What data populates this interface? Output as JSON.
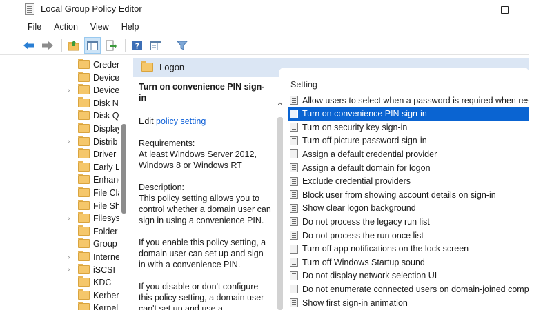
{
  "window": {
    "title": "Local Group Policy Editor"
  },
  "menu": [
    "File",
    "Action",
    "View",
    "Help"
  ],
  "toolbar": {
    "icons": [
      "back-arrow-icon",
      "forward-arrow-icon",
      "up-folder-icon",
      "show-hide-tree-icon",
      "export-list-icon",
      "help-icon",
      "extended-view-icon",
      "filter-icon"
    ]
  },
  "tree": {
    "items": [
      {
        "label": "Creden",
        "expandable": false
      },
      {
        "label": "Device",
        "expandable": false
      },
      {
        "label": "Device",
        "expandable": true
      },
      {
        "label": "Disk N",
        "expandable": false
      },
      {
        "label": "Disk Q",
        "expandable": false
      },
      {
        "label": "Display",
        "expandable": false
      },
      {
        "label": "Distrib",
        "expandable": true
      },
      {
        "label": "Driver",
        "expandable": false
      },
      {
        "label": "Early La",
        "expandable": false
      },
      {
        "label": "Enhanc",
        "expandable": false
      },
      {
        "label": "File Cla",
        "expandable": false
      },
      {
        "label": "File Sh",
        "expandable": false
      },
      {
        "label": "Filesys",
        "expandable": true
      },
      {
        "label": "Folder",
        "expandable": false
      },
      {
        "label": "Group",
        "expandable": false
      },
      {
        "label": "Interne",
        "expandable": true
      },
      {
        "label": "iSCSI",
        "expandable": true
      },
      {
        "label": "KDC",
        "expandable": false
      },
      {
        "label": "Kerbero",
        "expandable": false
      },
      {
        "label": "Kernel",
        "expandable": false
      }
    ]
  },
  "panel": {
    "folder_title": "Logon"
  },
  "description": {
    "title": "Turn on convenience PIN sign-in",
    "edit_prefix": "Edit",
    "edit_link": "policy setting",
    "requirements_label": "Requirements:",
    "requirements_text": "At least Windows Server 2012, Windows 8 or Windows RT",
    "description_label": "Description:",
    "description_text": "This policy setting allows you to control whether a domain user can sign in using a convenience PIN.",
    "enable_text": "If you enable this policy setting, a domain user can set up and sign in with a convenience PIN.",
    "disable_text": "If you disable or don't configure this policy setting, a domain user can't set up and use a convenience PIN."
  },
  "settings": {
    "column_header": "Setting",
    "selected_index": 1,
    "rows": [
      "Allow users to select when a password is required when resu...",
      "Turn on convenience PIN sign-in",
      "Turn on security key sign-in",
      "Turn off picture password sign-in",
      "Assign a default credential provider",
      "Assign a default domain for logon",
      "Exclude credential providers",
      "Block user from showing account details on sign-in",
      "Show clear logon background",
      "Do not process the legacy run list",
      "Do not process the run once list",
      "Turn off app notifications on the lock screen",
      "Turn off Windows Startup sound",
      "Do not display network selection UI",
      "Do not enumerate connected users on domain-joined comp...",
      "Show first sign-in animation"
    ]
  }
}
